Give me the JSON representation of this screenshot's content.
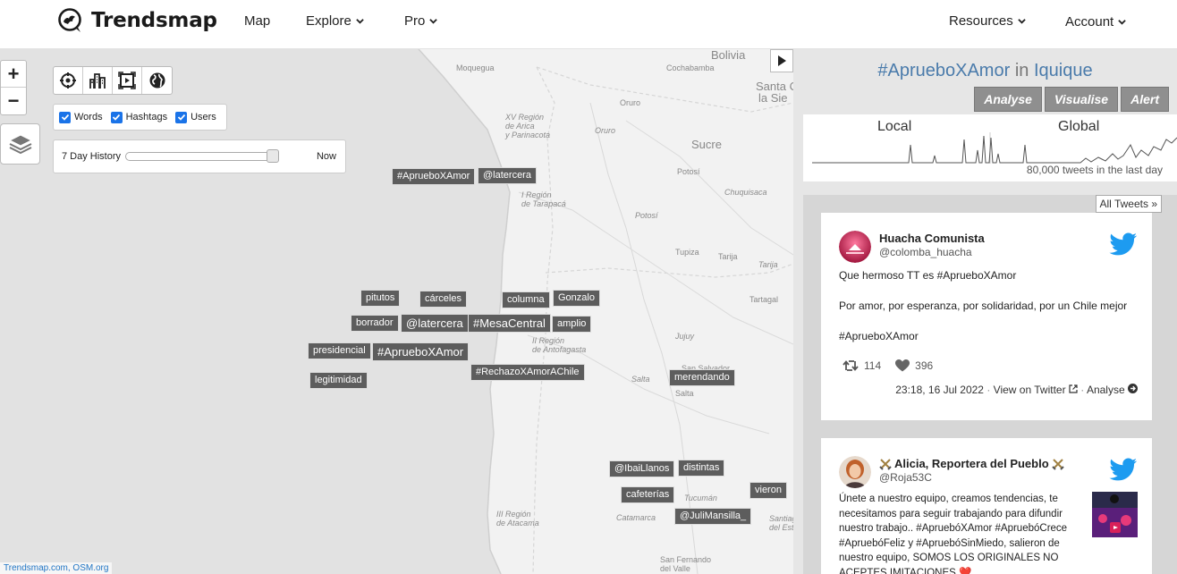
{
  "nav": {
    "brand": "Trendsmap",
    "items": [
      "Map",
      "Explore",
      "Pro"
    ],
    "right": [
      "Resources",
      "Account"
    ]
  },
  "map": {
    "places": [
      {
        "t": "Bolivia",
        "cls": "big"
      },
      {
        "t": "Moquegua",
        "cls": "city"
      },
      {
        "t": "Cochabamba",
        "cls": "city"
      },
      {
        "t": "Santa C",
        "cls": "big"
      },
      {
        "t": "la Sie",
        "cls": "big"
      },
      {
        "t": "XV Región\nde Arica\ny Parinacota",
        "cls": ""
      },
      {
        "t": "Oruro",
        "cls": "city"
      },
      {
        "t": "Oruro",
        "cls": ""
      },
      {
        "t": "Sucre",
        "cls": "big"
      },
      {
        "t": "Potosí",
        "cls": "city"
      },
      {
        "t": "Chuquisaca",
        "cls": ""
      },
      {
        "t": "I Región\nde Tarapacá",
        "cls": ""
      },
      {
        "t": "Potosí",
        "cls": ""
      },
      {
        "t": "Tupiza",
        "cls": "city"
      },
      {
        "t": "Tarija",
        "cls": "city"
      },
      {
        "t": "Tarija",
        "cls": ""
      },
      {
        "t": "Tartagal",
        "cls": "city"
      },
      {
        "t": "II Región\nde Antofagasta",
        "cls": ""
      },
      {
        "t": "Jujuy",
        "cls": ""
      },
      {
        "t": "San Salvador\nde Jujuy",
        "cls": "city"
      },
      {
        "t": "Salta",
        "cls": ""
      },
      {
        "t": "Salta",
        "cls": "city"
      },
      {
        "t": "Tucumán",
        "cls": ""
      },
      {
        "t": "III Región\nde Atacama",
        "cls": ""
      },
      {
        "t": "Catamarca",
        "cls": ""
      },
      {
        "t": "San Fernando\ndel Valle",
        "cls": "city"
      },
      {
        "t": "Santiago\ndel Estero",
        "cls": ""
      }
    ],
    "trends": [
      {
        "t": "#AprueboXAmor",
        "lg": false
      },
      {
        "t": "@latercera",
        "lg": false
      },
      {
        "t": "pitutos",
        "lg": false
      },
      {
        "t": "cárceles",
        "lg": false
      },
      {
        "t": "columna",
        "lg": false
      },
      {
        "t": "Gonzalo",
        "lg": false
      },
      {
        "t": "borrador",
        "lg": false
      },
      {
        "t": "@latercera",
        "lg": true
      },
      {
        "t": "#MesaCentral",
        "lg": true
      },
      {
        "t": "amplio",
        "lg": false
      },
      {
        "t": "presidencial",
        "lg": false
      },
      {
        "t": "#AprueboXAmor",
        "lg": true
      },
      {
        "t": "#RechazoXAmorAChile",
        "lg": false
      },
      {
        "t": "legitimidad",
        "lg": false
      },
      {
        "t": "merendando",
        "lg": false
      },
      {
        "t": "@IbaiLlanos",
        "lg": false
      },
      {
        "t": "distintas",
        "lg": false
      },
      {
        "t": "cafeterías",
        "lg": false
      },
      {
        "t": "vieron",
        "lg": false
      },
      {
        "t": "@JuliMansilla_",
        "lg": false
      }
    ],
    "zoom_in": "+",
    "zoom_out": "−",
    "filters": [
      "Words",
      "Hashtags",
      "Users"
    ],
    "history_label": "7 Day History",
    "history_now": "Now",
    "history_level": 1.0,
    "attribution": "Trendsmap.com, OSM.org"
  },
  "sidebar": {
    "hashtag": "#AprueboXAmor",
    "in_word": "in",
    "location": "Iquique",
    "buttons": [
      "Analyse",
      "Visualise",
      "Alert"
    ],
    "local": "Local",
    "global": "Global",
    "tweet_count": "80,000 tweets in the last day",
    "all_tweets": "All Tweets »",
    "tweets": [
      {
        "name": "Huacha Comunista",
        "handle": "@colomba_huacha",
        "lines": [
          "Que hermoso TT es #AprueboXAmor",
          "",
          "Por amor, por esperanza, por solidaridad, por un Chile mejor",
          "",
          "#AprueboXAmor"
        ],
        "retweets": "114",
        "likes": "396",
        "time": "23:18, 16 Jul 2022",
        "view": "View on Twitter",
        "analyse": "Analyse"
      },
      {
        "name": "Alicia, Reportera del Pueblo",
        "handle": "@Roja53C",
        "lines": [
          "Únete a nuestro equipo, creamos tendencias, te",
          "necesitamos para seguir trabajando para difundir",
          "nuestro trabajo.. #ApruebóXAmor #ApruebóCrece",
          "#ApruebóFeliz y #ApruebóSinMiedo, salieron de",
          "nuestro equipo, SOMOS LOS ORIGINALES NO",
          "ACEPTES IMITACIONES ❤️"
        ]
      }
    ]
  }
}
